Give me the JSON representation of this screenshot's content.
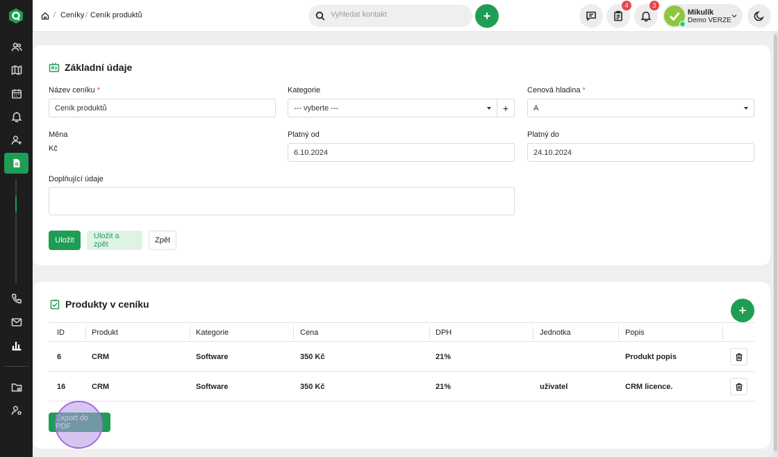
{
  "breadcrumb": {
    "home_icon": "home-icon",
    "items": [
      "Ceníky",
      "Ceník produktů"
    ]
  },
  "search": {
    "placeholder": "Vyhledat kontakt"
  },
  "topbar": {
    "add_label": "+",
    "notifications": [
      {
        "icon": "chat-icon",
        "badge": ""
      },
      {
        "icon": "clipboard-icon",
        "badge": "4"
      },
      {
        "icon": "bell-icon",
        "badge": "3"
      }
    ],
    "user": {
      "name": "Mikulík",
      "role": "Demo VERZE"
    },
    "theme_icon": "moon-icon"
  },
  "sidebar": {
    "items": [
      "contacts-icon",
      "map-icon",
      "calendar-icon",
      "bell-icon",
      "user-add-icon",
      "document-icon",
      "phone-icon",
      "mail-icon",
      "chart-icon",
      "folder-icon",
      "user-settings-icon"
    ],
    "active": "document-icon"
  },
  "form": {
    "title": "Základní údaje",
    "name_label": "Název ceníku",
    "name_value": "Ceník produktů",
    "category_label": "Kategorie",
    "category_value": "--- vyberte ---",
    "category_add": "+",
    "price_level_label": "Cenová hladina",
    "price_level_value": "A",
    "required_mark": "*",
    "currency_label": "Měna",
    "currency_value": "Kč",
    "valid_from_label": "Platný od",
    "valid_from_value": "6.10.2024",
    "valid_to_label": "Platný do",
    "valid_to_value": "24.10.2024",
    "extra_label": "Doplňující údaje",
    "extra_value": "",
    "save_label": "Uložit",
    "save_back_label": "Uložit a zpět",
    "back_label": "Zpět"
  },
  "products": {
    "title": "Produkty v ceníku",
    "add_label": "+",
    "columns": [
      "ID",
      "Produkt",
      "Kategorie",
      "Cena",
      "DPH",
      "Jednotka",
      "Popis"
    ],
    "rows": [
      {
        "id": "6",
        "product": "CRM",
        "category": "Software",
        "price": "350 Kč",
        "vat": "21%",
        "unit": "",
        "description": "Produkt popis"
      },
      {
        "id": "16",
        "product": "CRM",
        "category": "Software",
        "price": "350 Kč",
        "vat": "21%",
        "unit": "uživatel",
        "description": "CRM licence."
      }
    ],
    "export_label": "Export do PDF"
  },
  "colors": {
    "accent": "#1f9d55",
    "sidebar": "#1d1d1d",
    "badge": "#e8454c"
  }
}
